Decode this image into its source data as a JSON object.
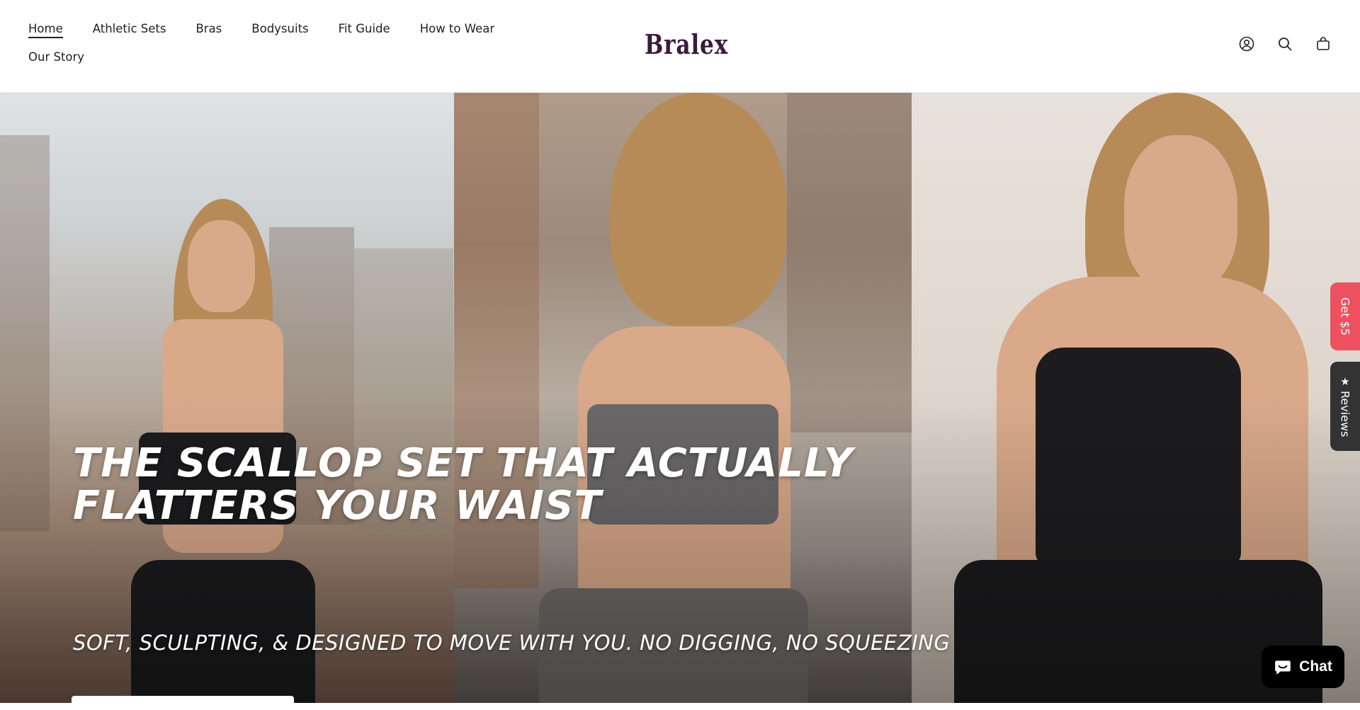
{
  "header": {
    "nav_items": [
      "Home",
      "Athletic Sets",
      "Bras",
      "Bodysuits",
      "Fit Guide",
      "How to Wear",
      "Our Story"
    ],
    "logo": "Bralex",
    "icons": [
      "account-icon",
      "search-icon",
      "cart-icon"
    ]
  },
  "hero": {
    "headline": "THE SCALLOP SET THAT ACTUALLY FLATTERS YOUR WAIST",
    "subheadline": "SOFT, SCULPTING, & DESIGNED TO MOVE WITH YOU. NO DIGGING, NO SQUEEZING"
  },
  "side_tabs": {
    "promo": "Get $5",
    "reviews": "Reviews"
  },
  "chat": {
    "label": "Chat"
  },
  "colors": {
    "logo": "#3b1a3a",
    "promo_tab": "#ef5060",
    "reviews_tab": "#333333",
    "chat_button": "#000000"
  }
}
